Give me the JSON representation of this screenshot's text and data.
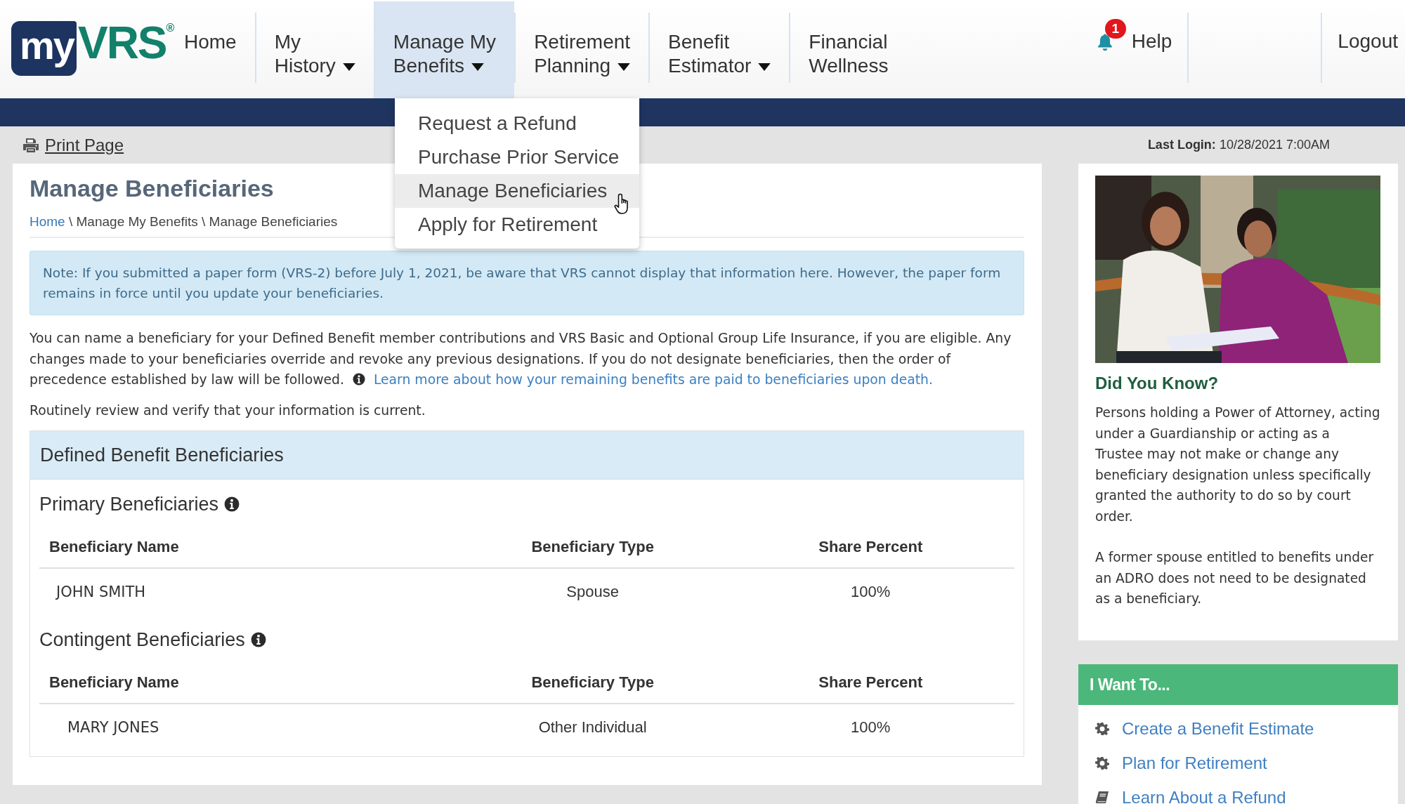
{
  "logo": {
    "badge": "my",
    "brand": "VRS",
    "mark": "®"
  },
  "nav": [
    {
      "lines": [
        "Home"
      ],
      "has_menu": false,
      "selected": false
    },
    {
      "lines": [
        "My",
        "History"
      ],
      "has_menu": true,
      "selected": false
    },
    {
      "lines": [
        "Manage My",
        "Benefits"
      ],
      "has_menu": true,
      "selected": true
    },
    {
      "lines": [
        "Retirement",
        "Planning"
      ],
      "has_menu": true,
      "selected": false
    },
    {
      "lines": [
        "Benefit",
        "Estimator"
      ],
      "has_menu": true,
      "selected": false
    },
    {
      "lines": [
        "Financial",
        "Wellness"
      ],
      "has_menu": false,
      "selected": false
    }
  ],
  "notifications": {
    "count": "1"
  },
  "help": "Help",
  "logout": "Logout",
  "dropdown": {
    "items": [
      {
        "label": "Request a Refund",
        "selected": false
      },
      {
        "label": "Purchase Prior Service",
        "selected": false
      },
      {
        "label": "Manage Beneficiaries",
        "selected": true
      },
      {
        "label": "Apply for Retirement",
        "selected": false
      }
    ]
  },
  "print_link": "Print Page",
  "last_login": {
    "label": "Last Login:",
    "value": "10/28/2021 7:00AM"
  },
  "page_title": "Manage Beneficiaries",
  "breadcrumb": {
    "separator": "\\",
    "items": [
      {
        "label": "Home",
        "link": true
      },
      {
        "label": "Manage My Benefits",
        "link": false
      },
      {
        "label": "Manage Beneficiaries",
        "link": false
      }
    ]
  },
  "note": "Note: If you submitted a paper form (VRS-2) before July 1, 2021, be aware that VRS cannot display that information here. However, the paper form remains in force until you update your beneficiaries.",
  "intro": {
    "text": "You can name a beneficiary for your Defined Benefit member contributions and VRS Basic and Optional Group Life Insurance, if you are eligible. Any changes made to your beneficiaries override and revoke any previous designations. If you do not designate beneficiaries, then the order of precedence established by law will be followed.",
    "link": "Learn more about how your remaining benefits are paid to beneficiaries upon death."
  },
  "reminder": "Routinely review and verify that your information is current.",
  "panel": {
    "title": "Defined Benefit Beneficiaries",
    "sections": [
      {
        "title": "Primary Beneficiaries",
        "columns": [
          "Beneficiary Name",
          "Beneficiary Type",
          "Share Percent"
        ],
        "rows": [
          [
            "JOHN SMITH",
            "Spouse",
            "100%"
          ]
        ]
      },
      {
        "title": "Contingent Beneficiaries",
        "columns": [
          "Beneficiary Name",
          "Beneficiary Type",
          "Share Percent"
        ],
        "rows": [
          [
            "MARY JONES",
            "Other Individual",
            "100%"
          ]
        ]
      }
    ]
  },
  "sidebar": {
    "picture": {
      "kind": "picture"
    },
    "heading": "Did You Know?",
    "paragraphs": [
      "Persons holding a Power of Attorney, acting under a Guardianship or acting as a Trustee may not make or change any beneficiary designation unless specifically granted the authority to do so by court order.",
      "A former spouse entitled to benefits under an ADRO does not need to be designated as a beneficiary."
    ],
    "actions": {
      "title": "I Want To...",
      "items": [
        {
          "label": "Create a Benefit Estimate",
          "kind": "gear"
        },
        {
          "label": "Plan for Retirement",
          "kind": "gear"
        },
        {
          "label": "Learn About a Refund",
          "kind": "book"
        }
      ]
    }
  }
}
